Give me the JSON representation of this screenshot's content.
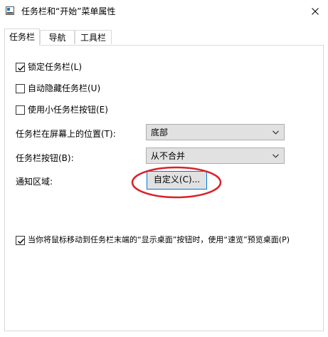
{
  "window": {
    "title": "任务栏和“开始”菜单属性",
    "close_icon": "close-icon",
    "app_icon": "taskbar-properties-icon"
  },
  "tabs": [
    {
      "label": "任务栏",
      "active": true
    },
    {
      "label": "导航",
      "active": false
    },
    {
      "label": "工具栏",
      "active": false
    }
  ],
  "checkboxes": {
    "lock_taskbar": {
      "label": "锁定任务栏(L)",
      "checked": true
    },
    "auto_hide": {
      "label": "自动隐藏任务栏(U)",
      "checked": false
    },
    "small_buttons": {
      "label": "使用小任务栏按钮(E)",
      "checked": false
    },
    "peek": {
      "label": "当你将鼠标移动到任务栏末端的“显示桌面”按钮时，使用“速览”预览桌面(P)",
      "checked": true
    }
  },
  "location": {
    "label": "任务栏在屏幕上的位置(T):",
    "value": "底部"
  },
  "buttons_combine": {
    "label": "任务栏按钮(B):",
    "value": "从不合并"
  },
  "notification_area": {
    "label": "通知区域:",
    "button_label": "自定义(C)..."
  },
  "colors": {
    "accent": "#0078d7",
    "highlight_ring": "#d9222a",
    "border": "#d9d9d9",
    "control_bg": "#e1e1e1"
  }
}
